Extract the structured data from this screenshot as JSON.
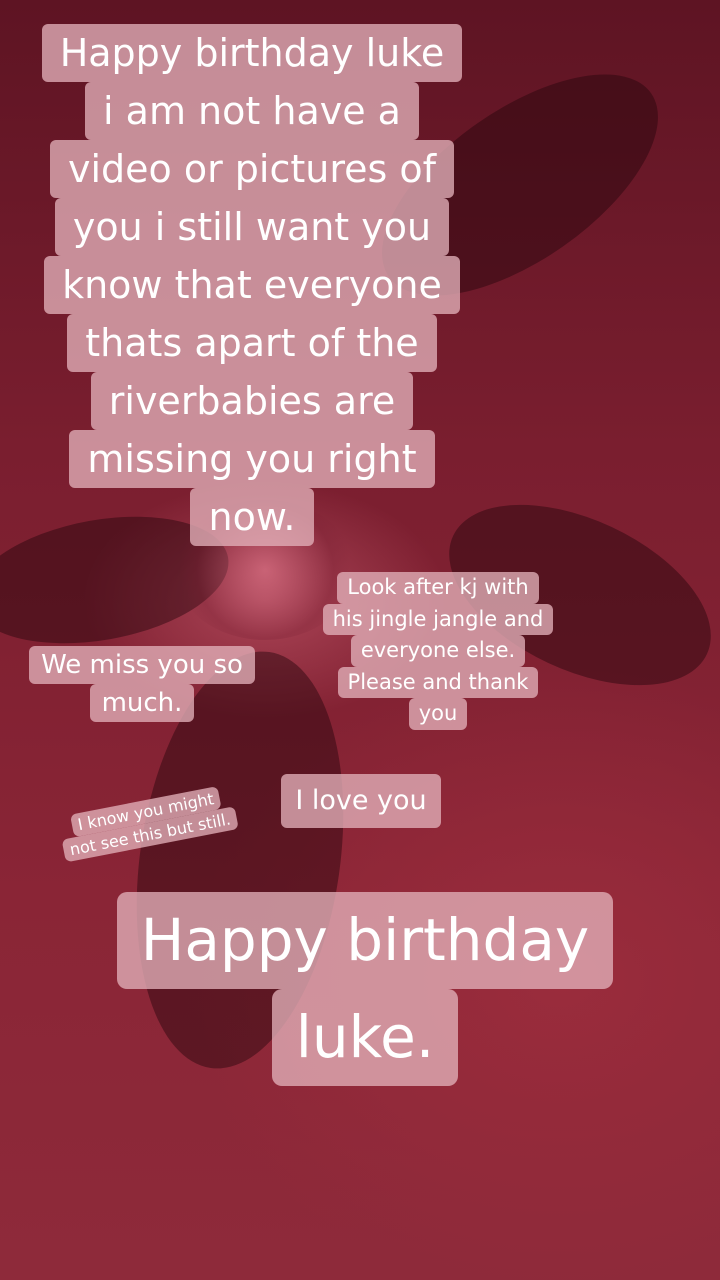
{
  "captions": {
    "main": [
      "Happy birthday luke",
      "i am not have a",
      "video or pictures of",
      "you i still want you",
      "know that everyone",
      "thats apart of the",
      "riverbabies are",
      "missing you right",
      "now."
    ],
    "look_after": [
      "Look after kj with",
      "his jingle jangle and",
      "everyone else.",
      "Please and thank",
      "you"
    ],
    "miss": [
      "We miss you so",
      "much."
    ],
    "love": [
      "I love you"
    ],
    "might_not": [
      "I know you might",
      "not see this but still."
    ],
    "big": [
      "Happy birthday",
      "luke."
    ]
  }
}
